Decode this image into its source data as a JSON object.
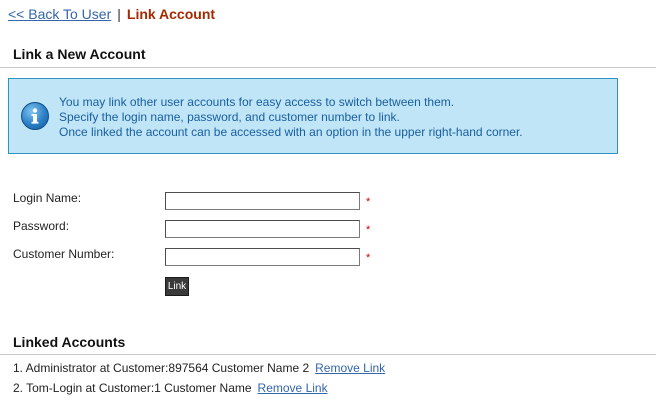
{
  "breadcrumb": {
    "back_label": "<< Back To User",
    "separator": "|",
    "current_label": "Link Account"
  },
  "link_section": {
    "title": "Link a New Account"
  },
  "info": {
    "icon": "info-icon",
    "lines": [
      "You may link other user accounts for easy access to switch between them.",
      "Specify the login name, password, and customer number to link.",
      "Once linked the account can be accessed with an option in the upper right-hand corner."
    ]
  },
  "form": {
    "login_name_label": "Login Name:",
    "login_name_value": "",
    "password_label": "Password:",
    "password_value": "",
    "customer_number_label": "Customer Number:",
    "customer_number_value": "",
    "required_marker": "*",
    "link_button_label": "Link"
  },
  "linked_section": {
    "title": "Linked Accounts",
    "accounts": [
      {
        "text": "1. Administrator at Customer:897564 Customer Name 2",
        "remove_label": "Remove Link"
      },
      {
        "text": "2. Tom-Login at Customer:1 Customer Name",
        "remove_label": "Remove Link"
      }
    ]
  },
  "colors": {
    "link": "#3366aa",
    "current_crumb": "#a52a00",
    "info_background": "#bfe5f7",
    "info_border": "#2f93bf",
    "info_text": "#1a5fa0",
    "required": "#cc0000",
    "button_background": "#3a3a3a"
  }
}
